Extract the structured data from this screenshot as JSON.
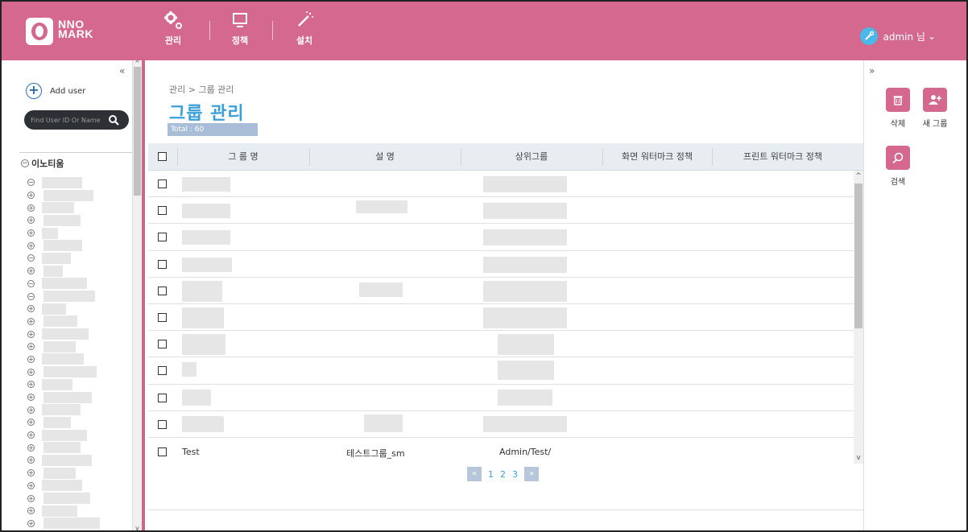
{
  "header": {
    "logo_line1": "NNO",
    "logo_line2": "MARK",
    "nav": [
      {
        "label": "관리",
        "icon": "gears-icon"
      },
      {
        "label": "정책",
        "icon": "monitor-icon"
      },
      {
        "label": "설치",
        "icon": "magic-wand-icon"
      }
    ],
    "user_label": "admin 님",
    "user_caret": "⌄"
  },
  "left_panel": {
    "collapse_glyph": "«",
    "add_user_label": "Add user",
    "search_placeholder": "Find User ID Or Name",
    "tree_root_label": "이노티움",
    "tree_nodes": [
      "−",
      "+",
      "+",
      "+",
      "+",
      "+",
      "−",
      "+",
      "−",
      "−",
      "+",
      "+",
      "+",
      "+",
      "+",
      "+",
      "+",
      "+",
      "+",
      "+",
      "+",
      "+",
      "+",
      "+",
      "+",
      "+",
      "+",
      "+",
      "+"
    ]
  },
  "main": {
    "breadcrumb": "관리 > 그룹 관리",
    "title": "그룹 관리",
    "total": "Total : 60",
    "columns": [
      "그 룹 명",
      "설 명",
      "상위그룹",
      "화면 워터마크 정책",
      "프린트 워터마크 정책"
    ],
    "last_row": {
      "name": "Test",
      "description": "테스트그룹_sm",
      "parent": "Admin/Test/"
    },
    "pager": {
      "prev": "«",
      "pages": [
        "1",
        "2",
        "3"
      ],
      "next": "»"
    }
  },
  "right_panel": {
    "collapse_glyph": "»",
    "actions": [
      {
        "label": "삭제",
        "icon": "trash-icon"
      },
      {
        "label": "새 그룹",
        "icon": "add-user-icon"
      },
      {
        "label": "검색",
        "icon": "search-icon"
      }
    ]
  },
  "colors": {
    "header_bg": "#d4688f",
    "accent": "#3b9fd9",
    "search_bg": "#2d3136"
  }
}
